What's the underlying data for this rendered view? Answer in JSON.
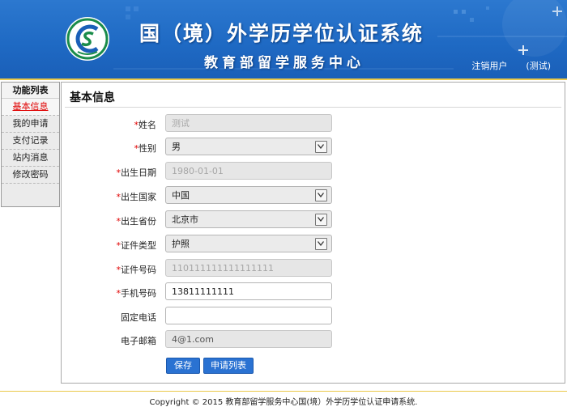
{
  "header": {
    "title": "国（境）外学历学位认证系统",
    "subtitle": "教育部留学服务中心",
    "logout_label": "注销用户",
    "user_label": "(测试)",
    "colors": {
      "banner": "#1f6ac4",
      "accent_line": "#e9c84a"
    }
  },
  "sidebar": {
    "title": "功能列表",
    "items": [
      {
        "label": "基本信息",
        "active": true
      },
      {
        "label": "我的申请"
      },
      {
        "label": "支付记录"
      },
      {
        "label": "站内消息"
      },
      {
        "label": "修改密码"
      }
    ]
  },
  "main": {
    "title": "基本信息",
    "fields": [
      {
        "label": "姓名",
        "required": true,
        "value": "测试",
        "type": "input",
        "disabled": true
      },
      {
        "label": "性别",
        "required": true,
        "value": "男",
        "type": "select"
      },
      {
        "label": "出生日期",
        "required": true,
        "value": "1980-01-01",
        "type": "input",
        "disabled": true
      },
      {
        "label": "出生国家",
        "required": true,
        "value": "中国",
        "type": "select"
      },
      {
        "label": "出生省份",
        "required": true,
        "value": "北京市",
        "type": "select"
      },
      {
        "label": "证件类型",
        "required": true,
        "value": "护照",
        "type": "select"
      },
      {
        "label": "证件号码",
        "required": true,
        "value": "110111111111111111",
        "type": "input",
        "disabled": true
      },
      {
        "label": "手机号码",
        "required": true,
        "value": "13811111111",
        "type": "input"
      },
      {
        "label": "固定电话",
        "required": false,
        "value": "",
        "type": "input"
      },
      {
        "label": "电子邮箱",
        "required": false,
        "value": "4@1.com",
        "type": "input",
        "disabled": true
      }
    ],
    "save_label": "保存",
    "list_label": "申请列表"
  },
  "footer": {
    "copyright": "Copyright © 2015 教育部留学服务中心国(境）外学历学位认证申请系统."
  }
}
